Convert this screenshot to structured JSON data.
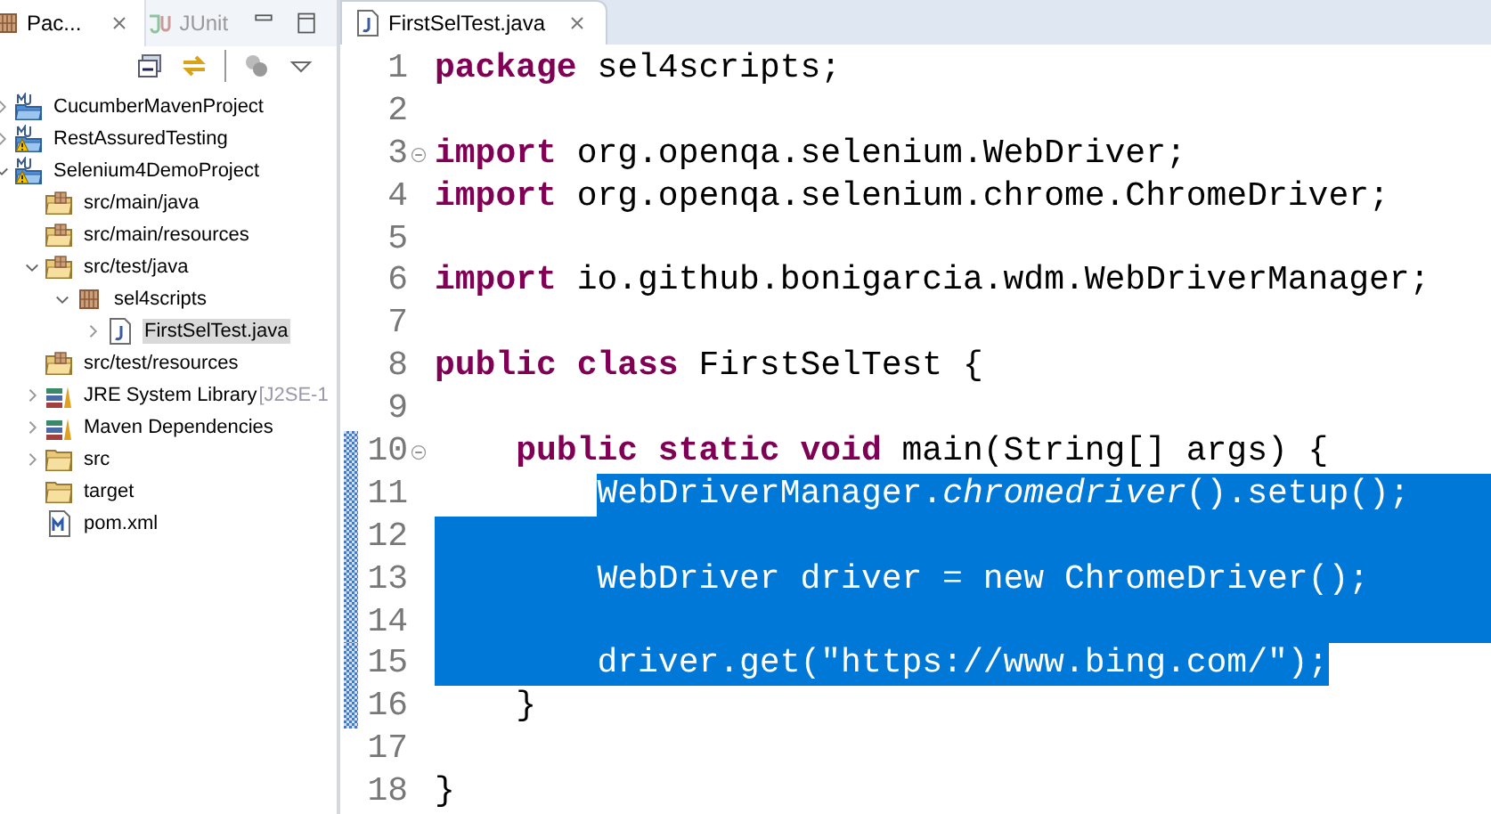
{
  "explorer": {
    "tabs": [
      {
        "label": "Pac...",
        "selected": true,
        "kind": "package"
      },
      {
        "label": "JUnit",
        "selected": false,
        "kind": "junit"
      }
    ],
    "tree": [
      {
        "label": "CucumberMavenProject",
        "kind": "project",
        "expanded": false
      },
      {
        "label": "RestAssuredTesting",
        "kind": "project",
        "warning": true,
        "expanded": false
      },
      {
        "label": "Selenium4DemoProject",
        "kind": "project",
        "warning": true,
        "expanded": true,
        "children": [
          {
            "label": "src/main/java",
            "kind": "source"
          },
          {
            "label": "src/main/resources",
            "kind": "source"
          },
          {
            "label": "src/test/java",
            "kind": "source",
            "expanded": true,
            "children": [
              {
                "label": "sel4scripts",
                "kind": "package",
                "expanded": true,
                "children": [
                  {
                    "label": "FirstSelTest.java",
                    "kind": "javafile",
                    "expanded": false,
                    "selected": true
                  }
                ]
              }
            ]
          },
          {
            "label": "src/test/resources",
            "kind": "source"
          },
          {
            "label": "JRE System Library",
            "decoration": "[J2SE-1",
            "kind": "library",
            "expanded": false
          },
          {
            "label": "Maven Dependencies",
            "kind": "library",
            "expanded": false
          },
          {
            "label": "src",
            "kind": "folder",
            "expanded": false
          },
          {
            "label": "target",
            "kind": "folder"
          },
          {
            "label": "pom.xml",
            "kind": "xmlfile"
          }
        ]
      }
    ]
  },
  "editor": {
    "tab": {
      "label": "FirstSelTest.java",
      "selected": true
    },
    "lines": [
      {
        "number": "1",
        "segments": [
          {
            "kind": "keyword",
            "text": "package"
          },
          {
            "kind": "plain",
            "text": " sel4scripts;"
          }
        ]
      },
      {
        "number": "2"
      },
      {
        "number": "3",
        "folded": false,
        "segments": [
          {
            "kind": "keyword",
            "text": "import"
          },
          {
            "kind": "plain",
            "text": " org.openqa.selenium.WebDriver;"
          }
        ]
      },
      {
        "number": "4",
        "segments": [
          {
            "kind": "keyword",
            "text": "import"
          },
          {
            "kind": "plain",
            "text": " org.openqa.selenium.chrome.ChromeDriver;"
          }
        ]
      },
      {
        "number": "5"
      },
      {
        "number": "6",
        "segments": [
          {
            "kind": "keyword",
            "text": "import"
          },
          {
            "kind": "plain",
            "text": " io.github.bonigarcia.wdm.WebDriverManager;"
          }
        ]
      },
      {
        "number": "7"
      },
      {
        "number": "8",
        "segments": [
          {
            "kind": "keyword",
            "text": "public class"
          },
          {
            "kind": "plain",
            "text": " FirstSelTest {"
          }
        ]
      },
      {
        "number": "9"
      },
      {
        "number": "10",
        "folded": false,
        "range_marker": true,
        "segments": [
          {
            "kind": "keyword",
            "text": "    public static void"
          },
          {
            "kind": "plain",
            "text": " main(String[] args) {"
          }
        ]
      },
      {
        "number": "11",
        "selected": true,
        "range_marker": true,
        "segments": [
          {
            "kind": "plain",
            "text": "        WebDriverManager."
          },
          {
            "kind": "italic",
            "text": "chromedriver"
          },
          {
            "kind": "plain",
            "text": "().setup();"
          }
        ]
      },
      {
        "number": "12",
        "selected": true,
        "range_marker": true
      },
      {
        "number": "13",
        "selected": true,
        "range_marker": true,
        "segments": [
          {
            "kind": "plain",
            "text": "        WebDriver driver = "
          },
          {
            "kind": "keyword",
            "text": "new"
          },
          {
            "kind": "plain",
            "text": " ChromeDriver();"
          }
        ]
      },
      {
        "number": "14",
        "selected": true,
        "range_marker": true
      },
      {
        "number": "15",
        "selected": true,
        "range_marker": true,
        "segments": [
          {
            "kind": "plain",
            "text": "        driver.get(\"https://www.bing.com/\");"
          }
        ]
      },
      {
        "number": "16",
        "range_marker": true,
        "segments": [
          {
            "kind": "plain",
            "text": "    }"
          }
        ]
      },
      {
        "number": "17"
      },
      {
        "number": "18",
        "segments": [
          {
            "kind": "plain",
            "text": "}"
          }
        ]
      }
    ]
  }
}
